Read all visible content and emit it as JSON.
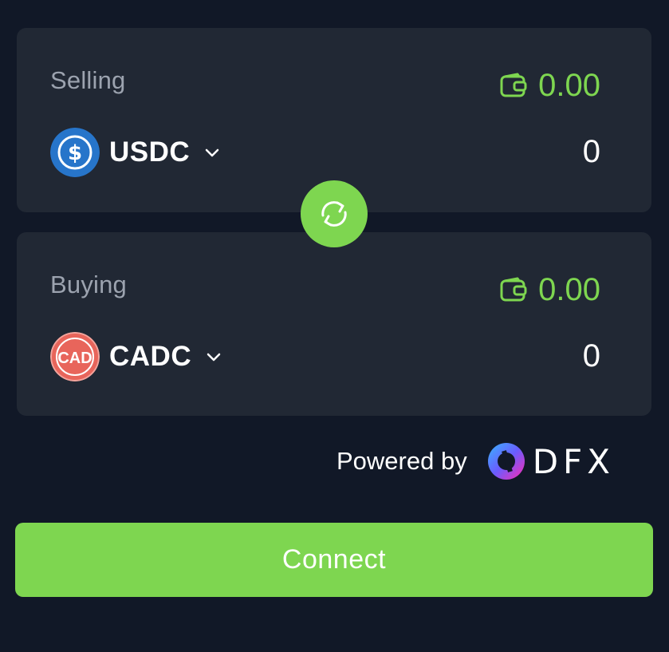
{
  "selling": {
    "label": "Selling",
    "balance": "0.00",
    "token": "USDC",
    "token_icon": "usdc-icon",
    "amount": "0"
  },
  "buying": {
    "label": "Buying",
    "balance": "0.00",
    "token": "CADC",
    "token_icon": "cadc-icon",
    "token_icon_text": "CAD",
    "amount": "0"
  },
  "swap_icon": "swap-icon",
  "powered_by": {
    "text": "Powered by",
    "brand": "DFX"
  },
  "connect_label": "Connect",
  "colors": {
    "background": "#111827",
    "card": "#212834",
    "accent": "#7ed650",
    "label": "#9ca3af",
    "usdc_blue": "#2775ca",
    "cadc_red": "#e8655b"
  }
}
